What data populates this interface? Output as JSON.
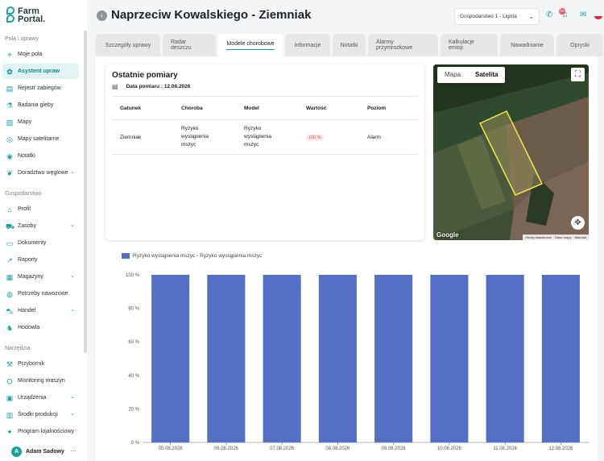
{
  "app": {
    "logo_line1": "Farm",
    "logo_line2": "Portal."
  },
  "sidebar": {
    "sections": [
      {
        "title": "Pola i uprawy"
      },
      {
        "title": "Gospodarstwo"
      },
      {
        "title": "Narzędzia"
      }
    ],
    "items": [
      {
        "label": "Moje pola",
        "icon": "map-pin-icon"
      },
      {
        "label": "Asystent upraw",
        "icon": "sprout-icon"
      },
      {
        "label": "Rejestr zabiegów",
        "icon": "clipboard-icon"
      },
      {
        "label": "Badania gleby",
        "icon": "flask-icon"
      },
      {
        "label": "Mapy",
        "icon": "map-icon"
      },
      {
        "label": "Mapy satelitarne",
        "icon": "satellite-icon"
      },
      {
        "label": "Notatki",
        "icon": "eye-icon"
      },
      {
        "label": "Doradztwo węglowe",
        "icon": "leaf-icon"
      },
      {
        "label": "Profil",
        "icon": "home-icon"
      },
      {
        "label": "Zasoby",
        "icon": "truck-icon"
      },
      {
        "label": "Dokumenty",
        "icon": "document-icon"
      },
      {
        "label": "Raporty",
        "icon": "chart-line-icon"
      },
      {
        "label": "Magazyny",
        "icon": "warehouse-icon"
      },
      {
        "label": "Potrzeby nawozowe",
        "icon": "bag-icon"
      },
      {
        "label": "Handel",
        "icon": "cart-icon"
      },
      {
        "label": "Hodowla",
        "icon": "cow-icon"
      },
      {
        "label": "Przybornik",
        "icon": "toolbox-icon"
      },
      {
        "label": "Monitoring maszyn",
        "icon": "tractor-icon"
      },
      {
        "label": "Urządzenia",
        "icon": "device-icon"
      },
      {
        "label": "Środki produkcji",
        "icon": "box-icon"
      },
      {
        "label": "Program lojalnościowy",
        "icon": "gift-icon"
      }
    ],
    "user": {
      "name": "Adam Sadowy",
      "initial": "A",
      "more": "···"
    }
  },
  "header": {
    "title": "Naprzeciw Kowalskiego - Ziemniak",
    "farm_select": "Gospodarstwo 1 - Ligota",
    "notifications_count": "9+"
  },
  "tabs": [
    "Szczegóły uprawy",
    "Radar deszczu",
    "Modele chorobowe",
    "Informacje",
    "Notatki",
    "Alarmy przymrozkowe",
    "Kalkulacje emisji",
    "Nawadnianie",
    "Opryski"
  ],
  "measurements": {
    "title": "Ostatnie pomiary",
    "date_label": "Data pomiaru : 12.08.2026",
    "columns": [
      "Gatunek",
      "Choroba",
      "Model",
      "Wartość",
      "Poziom"
    ],
    "rows": [
      {
        "species": "Ziemniak",
        "disease": "Ryzyko wystąpienia mszyc",
        "model": "Ryzyko wystąpienia mszyc",
        "value": "100 %",
        "level": "Alarm"
      }
    ]
  },
  "map": {
    "view_map": "Mapa",
    "view_satellite": "Satelita",
    "google": "Google",
    "footer": [
      "Skróty klawiszowe",
      "Dane mapy",
      "Warunki"
    ]
  },
  "chart_data": {
    "type": "bar",
    "categories": [
      "05.08.2026",
      "06.08.2026",
      "07.08.2026",
      "08.08.2026",
      "09.08.2026",
      "10.08.2026",
      "11.08.2026",
      "12.08.2026"
    ],
    "series": [
      {
        "name": "Ryzyko wystąpienia mszyc - Ryzyko wystąpienia mszyc",
        "values": [
          100,
          100,
          100,
          100,
          100,
          100,
          100,
          100
        ],
        "color": "#5470c6"
      }
    ],
    "yticks": [
      "0 %",
      "20 %",
      "40 %",
      "60 %",
      "80 %",
      "100 %"
    ],
    "ylim": [
      0,
      100
    ],
    "legend_position": "top-left"
  }
}
